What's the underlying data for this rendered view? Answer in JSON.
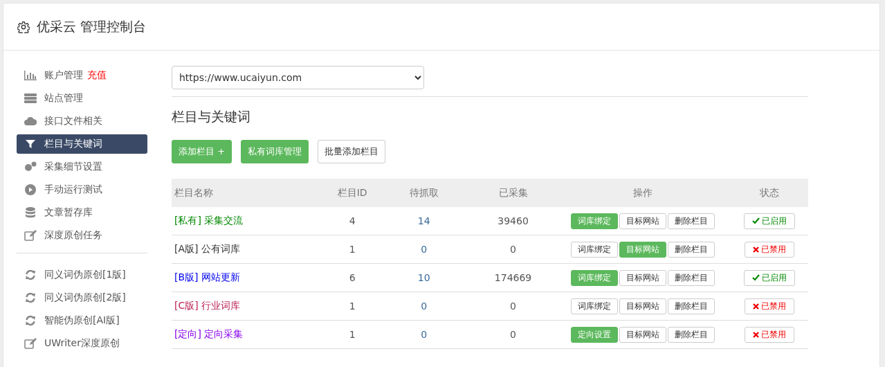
{
  "header": {
    "title": "优采云 管理控制台"
  },
  "sidebar": {
    "groups": [
      {
        "items": [
          {
            "label": "账户管理",
            "badge": "充值",
            "selected": false
          },
          {
            "label": "站点管理",
            "selected": false
          },
          {
            "label": "接口文件相关",
            "selected": false
          },
          {
            "label": "栏目与关键词",
            "selected": true
          },
          {
            "label": "采集细节设置",
            "selected": false
          },
          {
            "label": "手动运行测试",
            "selected": false
          },
          {
            "label": "文章暂存库",
            "selected": false
          },
          {
            "label": "深度原创任务",
            "selected": false
          }
        ]
      },
      {
        "items": [
          {
            "label": "同义词伪原创[1版]",
            "selected": false
          },
          {
            "label": "同义词伪原创[2版]",
            "selected": false
          },
          {
            "label": "智能伪原创[AI版]",
            "selected": false
          },
          {
            "label": "UWriter深度原创",
            "selected": false
          }
        ]
      }
    ]
  },
  "site_select": {
    "value": "https://www.ucaiyun.com"
  },
  "section_title": "栏目与关键词",
  "toolbar": [
    {
      "label": "添加栏目 +",
      "kind": "green"
    },
    {
      "label": "私有词库管理",
      "kind": "green"
    },
    {
      "label": "批量添加栏目",
      "kind": "plain"
    }
  ],
  "table": {
    "columns": [
      "栏目名称",
      "栏目ID",
      "待抓取",
      "已采集",
      "操作",
      "状态"
    ],
    "rows": [
      {
        "name": "[私有] 采集交流",
        "color": "#008800",
        "id": "4",
        "pending": "14",
        "collected": "39460",
        "actions": [
          {
            "label": "词库绑定",
            "primary": true
          },
          {
            "label": "目标网站",
            "primary": false
          },
          {
            "label": "删除栏目",
            "primary": false
          }
        ],
        "status": {
          "label": "已启用",
          "enabled": true
        }
      },
      {
        "name": "[A版] 公有词库",
        "color": "#333333",
        "id": "1",
        "pending": "0",
        "collected": "0",
        "actions": [
          {
            "label": "词库绑定",
            "primary": false
          },
          {
            "label": "目标网站",
            "primary": true
          },
          {
            "label": "删除栏目",
            "primary": false
          }
        ],
        "status": {
          "label": "已禁用",
          "enabled": false
        }
      },
      {
        "name": "[B版] 网站更新",
        "color": "#0000ee",
        "id": "6",
        "pending": "10",
        "collected": "174669",
        "actions": [
          {
            "label": "词库绑定",
            "primary": true
          },
          {
            "label": "目标网站",
            "primary": false
          },
          {
            "label": "删除栏目",
            "primary": false
          }
        ],
        "status": {
          "label": "已启用",
          "enabled": true
        }
      },
      {
        "name": "[C版] 行业词库",
        "color": "#bb2255",
        "id": "1",
        "pending": "0",
        "collected": "0",
        "actions": [
          {
            "label": "词库绑定",
            "primary": false
          },
          {
            "label": "目标网站",
            "primary": false
          },
          {
            "label": "删除栏目",
            "primary": false
          }
        ],
        "status": {
          "label": "已禁用",
          "enabled": false
        }
      },
      {
        "name": "[定向] 定向采集",
        "color": "#8800ee",
        "id": "1",
        "pending": "0",
        "collected": "0",
        "actions": [
          {
            "label": "定向设置",
            "primary": true
          },
          {
            "label": "目标网站",
            "primary": false
          },
          {
            "label": "删除栏目",
            "primary": false
          }
        ],
        "status": {
          "label": "已禁用",
          "enabled": false
        }
      }
    ]
  }
}
